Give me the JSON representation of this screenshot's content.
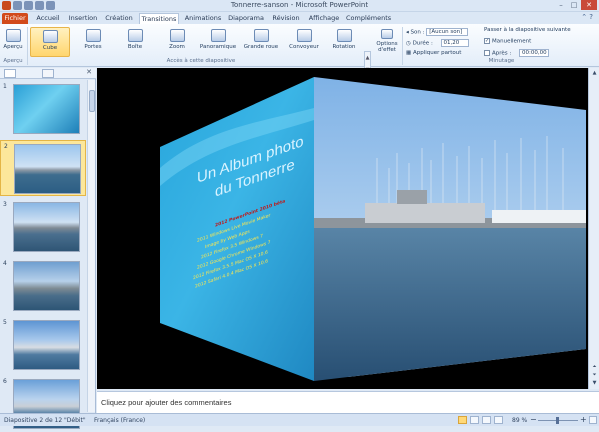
{
  "window": {
    "title": "Tonnerre-sanson - Microsoft PowerPoint"
  },
  "tabs": [
    {
      "label": "Fichier"
    },
    {
      "label": "Accueil"
    },
    {
      "label": "Insertion"
    },
    {
      "label": "Création"
    },
    {
      "label": "Transitions"
    },
    {
      "label": "Animations"
    },
    {
      "label": "Diaporama"
    },
    {
      "label": "Révision"
    },
    {
      "label": "Affichage"
    },
    {
      "label": "Compléments"
    }
  ],
  "ribbon": {
    "preview_label": "Aperçu",
    "preview_group": "Aperçu",
    "transitions": [
      {
        "label": "Cube"
      },
      {
        "label": "Portes"
      },
      {
        "label": "Boîte"
      },
      {
        "label": "Zoom"
      },
      {
        "label": "Panoramique"
      },
      {
        "label": "Grande roue"
      },
      {
        "label": "Convoyeur"
      },
      {
        "label": "Rotation"
      }
    ],
    "transitions_group": "Accès à cette diapositive",
    "effect_options_line1": "Options",
    "effect_options_line2": "d'effet",
    "sound_label": "Son :",
    "sound_value": "[Aucun son]",
    "duration_label": "Durée :",
    "duration_value": "01,20",
    "apply_all": "Appliquer partout",
    "advance_title": "Passer à la diapositive suivante",
    "manual_label": "Manuellement",
    "after_label": "Après :",
    "after_value": "00:00,00",
    "timing_group": "Minutage"
  },
  "slides_pane": {
    "slides": [
      {
        "number": "1"
      },
      {
        "number": "2"
      },
      {
        "number": "3"
      },
      {
        "number": "4"
      },
      {
        "number": "5"
      },
      {
        "number": "6"
      }
    ]
  },
  "slide": {
    "title_line1": "Un Album photo",
    "title_line2": "du Tonnerre",
    "body_heading": "2012 PowerPoint 2010 bêta",
    "body_lines": [
      "2011 Windows Live Movie Maker",
      "Image by Web Apps",
      "2012 Firefox 3.5 Windows 7",
      "2012 Google Chrome Windows 7",
      "2012 Firefox 3.5.5 Mac OS X 10.6",
      "2012 Safari 4.0.4 Mac OS X 10.6"
    ]
  },
  "notes": {
    "placeholder": "Cliquez pour ajouter des commentaires"
  },
  "status": {
    "slide_info": "Diapositive 2 de 12",
    "theme": "\"Débit\"",
    "language": "Français (France)",
    "zoom": "89 %"
  }
}
